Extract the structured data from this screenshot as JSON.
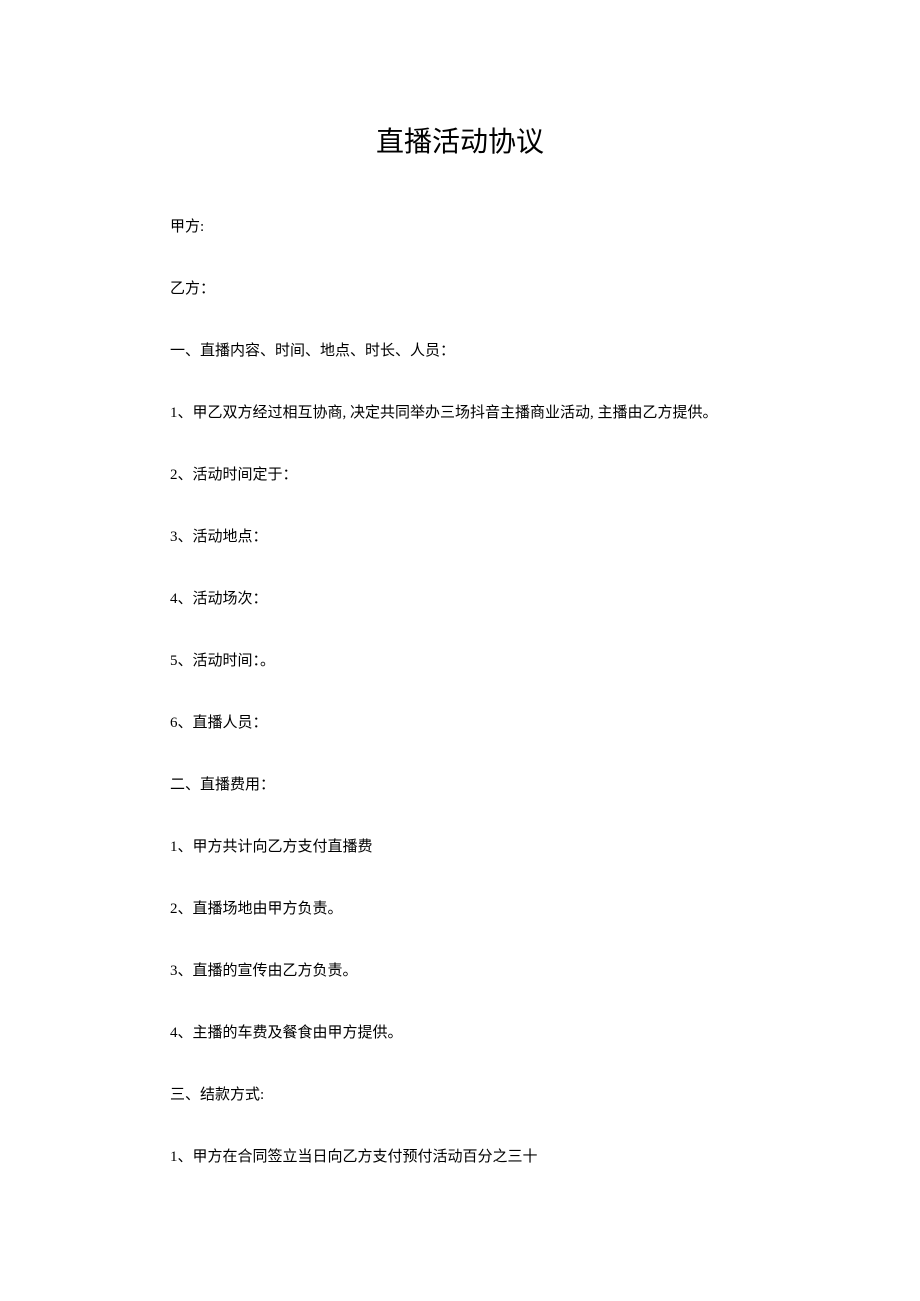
{
  "title": "直播活动协议",
  "lines": {
    "l1": "甲方:",
    "l2": "乙方：",
    "l3": "一、直播内容、时间、地点、时长、人员：",
    "l4": "1、甲乙双方经过相互协商, 决定共同举办三场抖音主播商业活动, 主播由乙方提供。",
    "l5": "2、活动时间定于：",
    "l6": "3、活动地点：",
    "l7": "4、活动场次：",
    "l8": "5、活动时间：。",
    "l9": "6、直播人员：",
    "l10": "二、直播费用：",
    "l11": "1、甲方共计向乙方支付直播费",
    "l12": "2、直播场地由甲方负责。",
    "l13": "3、直播的宣传由乙方负责。",
    "l14": "4、主播的车费及餐食由甲方提供。",
    "l15": "三、结款方式:",
    "l16": "1、甲方在合同签立当日向乙方支付预付活动百分之三十"
  }
}
